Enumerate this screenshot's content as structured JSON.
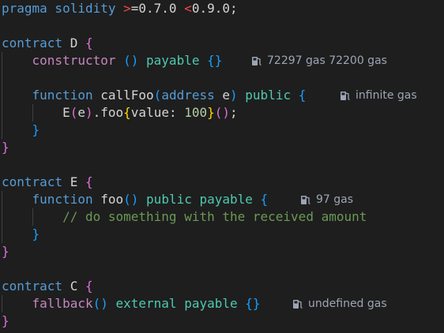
{
  "colors": {
    "background": "#1e1e1e",
    "keyword_blue": "#569cd6",
    "type_green": "#4ec9b0",
    "function_yellow": "#dcdcaa",
    "string_orange": "#ce9178",
    "comment_green": "#6a9955",
    "number_light": "#b5cea8",
    "bracket_pink": "#da70d6",
    "bracket_blue": "#179fff",
    "operator_red": "#f44747",
    "identifier": "#9cdcfe",
    "gas_hint": "#9da5b4"
  },
  "lines": [
    {
      "tokens": [
        {
          "t": "pragma solidity ",
          "c": "#569cd6"
        },
        {
          "t": ">",
          "c": "#f44747"
        },
        {
          "t": "=0.7.0 ",
          "c": "#d4d4d4"
        },
        {
          "t": "<",
          "c": "#f44747"
        },
        {
          "t": "0.9.0;",
          "c": "#d4d4d4"
        }
      ]
    },
    {
      "tokens": []
    },
    {
      "tokens": [
        {
          "t": "contract ",
          "c": "#569cd6"
        },
        {
          "t": "D ",
          "c": "#d4d4d4"
        },
        {
          "t": "{",
          "c": "#da70d6"
        }
      ]
    },
    {
      "tokens": [
        {
          "t": "    ",
          "c": "#d4d4d4"
        },
        {
          "t": "constructor ",
          "c": "#c586c0"
        },
        {
          "t": "() ",
          "c": "#179fff"
        },
        {
          "t": "payable ",
          "c": "#4ec9b0"
        },
        {
          "t": "{}",
          "c": "#179fff"
        }
      ]
    },
    {
      "tokens": []
    },
    {
      "tokens": [
        {
          "t": "    ",
          "c": "#d4d4d4"
        },
        {
          "t": "function ",
          "c": "#569cd6"
        },
        {
          "t": "callFoo",
          "c": "#d4d4d4"
        },
        {
          "t": "(",
          "c": "#179fff"
        },
        {
          "t": "address ",
          "c": "#569cd6"
        },
        {
          "t": "e",
          "c": "#d4d4d4"
        },
        {
          "t": ") ",
          "c": "#179fff"
        },
        {
          "t": "public ",
          "c": "#4ec9b0"
        },
        {
          "t": "{",
          "c": "#179fff"
        }
      ]
    },
    {
      "tokens": [
        {
          "t": "        ",
          "c": "#d4d4d4"
        },
        {
          "t": "E",
          "c": "#d4d4d4"
        },
        {
          "t": "(",
          "c": "#da70d6"
        },
        {
          "t": "e",
          "c": "#d4d4d4"
        },
        {
          "t": ")",
          "c": "#da70d6"
        },
        {
          "t": ".foo",
          "c": "#d4d4d4"
        },
        {
          "t": "{",
          "c": "#ffd700"
        },
        {
          "t": "value: ",
          "c": "#d4d4d4"
        },
        {
          "t": "100",
          "c": "#b5cea8"
        },
        {
          "t": "}",
          "c": "#ffd700"
        },
        {
          "t": "()",
          "c": "#da70d6"
        },
        {
          "t": ";",
          "c": "#d4d4d4"
        }
      ]
    },
    {
      "tokens": [
        {
          "t": "    ",
          "c": "#d4d4d4"
        },
        {
          "t": "}",
          "c": "#179fff"
        }
      ]
    },
    {
      "tokens": [
        {
          "t": "}",
          "c": "#da70d6"
        }
      ]
    },
    {
      "tokens": []
    },
    {
      "tokens": [
        {
          "t": "contract ",
          "c": "#569cd6"
        },
        {
          "t": "E ",
          "c": "#d4d4d4"
        },
        {
          "t": "{",
          "c": "#da70d6"
        }
      ]
    },
    {
      "tokens": [
        {
          "t": "    ",
          "c": "#d4d4d4"
        },
        {
          "t": "function ",
          "c": "#569cd6"
        },
        {
          "t": "foo",
          "c": "#d4d4d4"
        },
        {
          "t": "() ",
          "c": "#179fff"
        },
        {
          "t": "public ",
          "c": "#4ec9b0"
        },
        {
          "t": "payable ",
          "c": "#4ec9b0"
        },
        {
          "t": "{",
          "c": "#179fff"
        }
      ]
    },
    {
      "tokens": [
        {
          "t": "        ",
          "c": "#d4d4d4"
        },
        {
          "t": "// do something with the received amount",
          "c": "#6a9955"
        }
      ]
    },
    {
      "tokens": [
        {
          "t": "    ",
          "c": "#d4d4d4"
        },
        {
          "t": "}",
          "c": "#179fff"
        }
      ]
    },
    {
      "tokens": [
        {
          "t": "}",
          "c": "#da70d6"
        }
      ]
    },
    {
      "tokens": []
    },
    {
      "tokens": [
        {
          "t": "contract ",
          "c": "#569cd6"
        },
        {
          "t": "C ",
          "c": "#d4d4d4"
        },
        {
          "t": "{",
          "c": "#da70d6"
        }
      ]
    },
    {
      "tokens": [
        {
          "t": "    ",
          "c": "#d4d4d4"
        },
        {
          "t": "fallback",
          "c": "#c586c0"
        },
        {
          "t": "() ",
          "c": "#179fff"
        },
        {
          "t": "external ",
          "c": "#4ec9b0"
        },
        {
          "t": "payable ",
          "c": "#4ec9b0"
        },
        {
          "t": "{}",
          "c": "#179fff"
        }
      ]
    },
    {
      "tokens": [
        {
          "t": "}",
          "c": "#da70d6"
        }
      ]
    }
  ],
  "gas_hints": [
    {
      "line": 3,
      "text": "72297 gas 72200 gas",
      "icon": "gas-pump-icon"
    },
    {
      "line": 5,
      "text": "infinite gas",
      "icon": "gas-pump-icon"
    },
    {
      "line": 11,
      "text": "97 gas",
      "icon": "gas-pump-icon"
    },
    {
      "line": 17,
      "text": "undefined gas",
      "icon": "gas-pump-icon"
    }
  ]
}
